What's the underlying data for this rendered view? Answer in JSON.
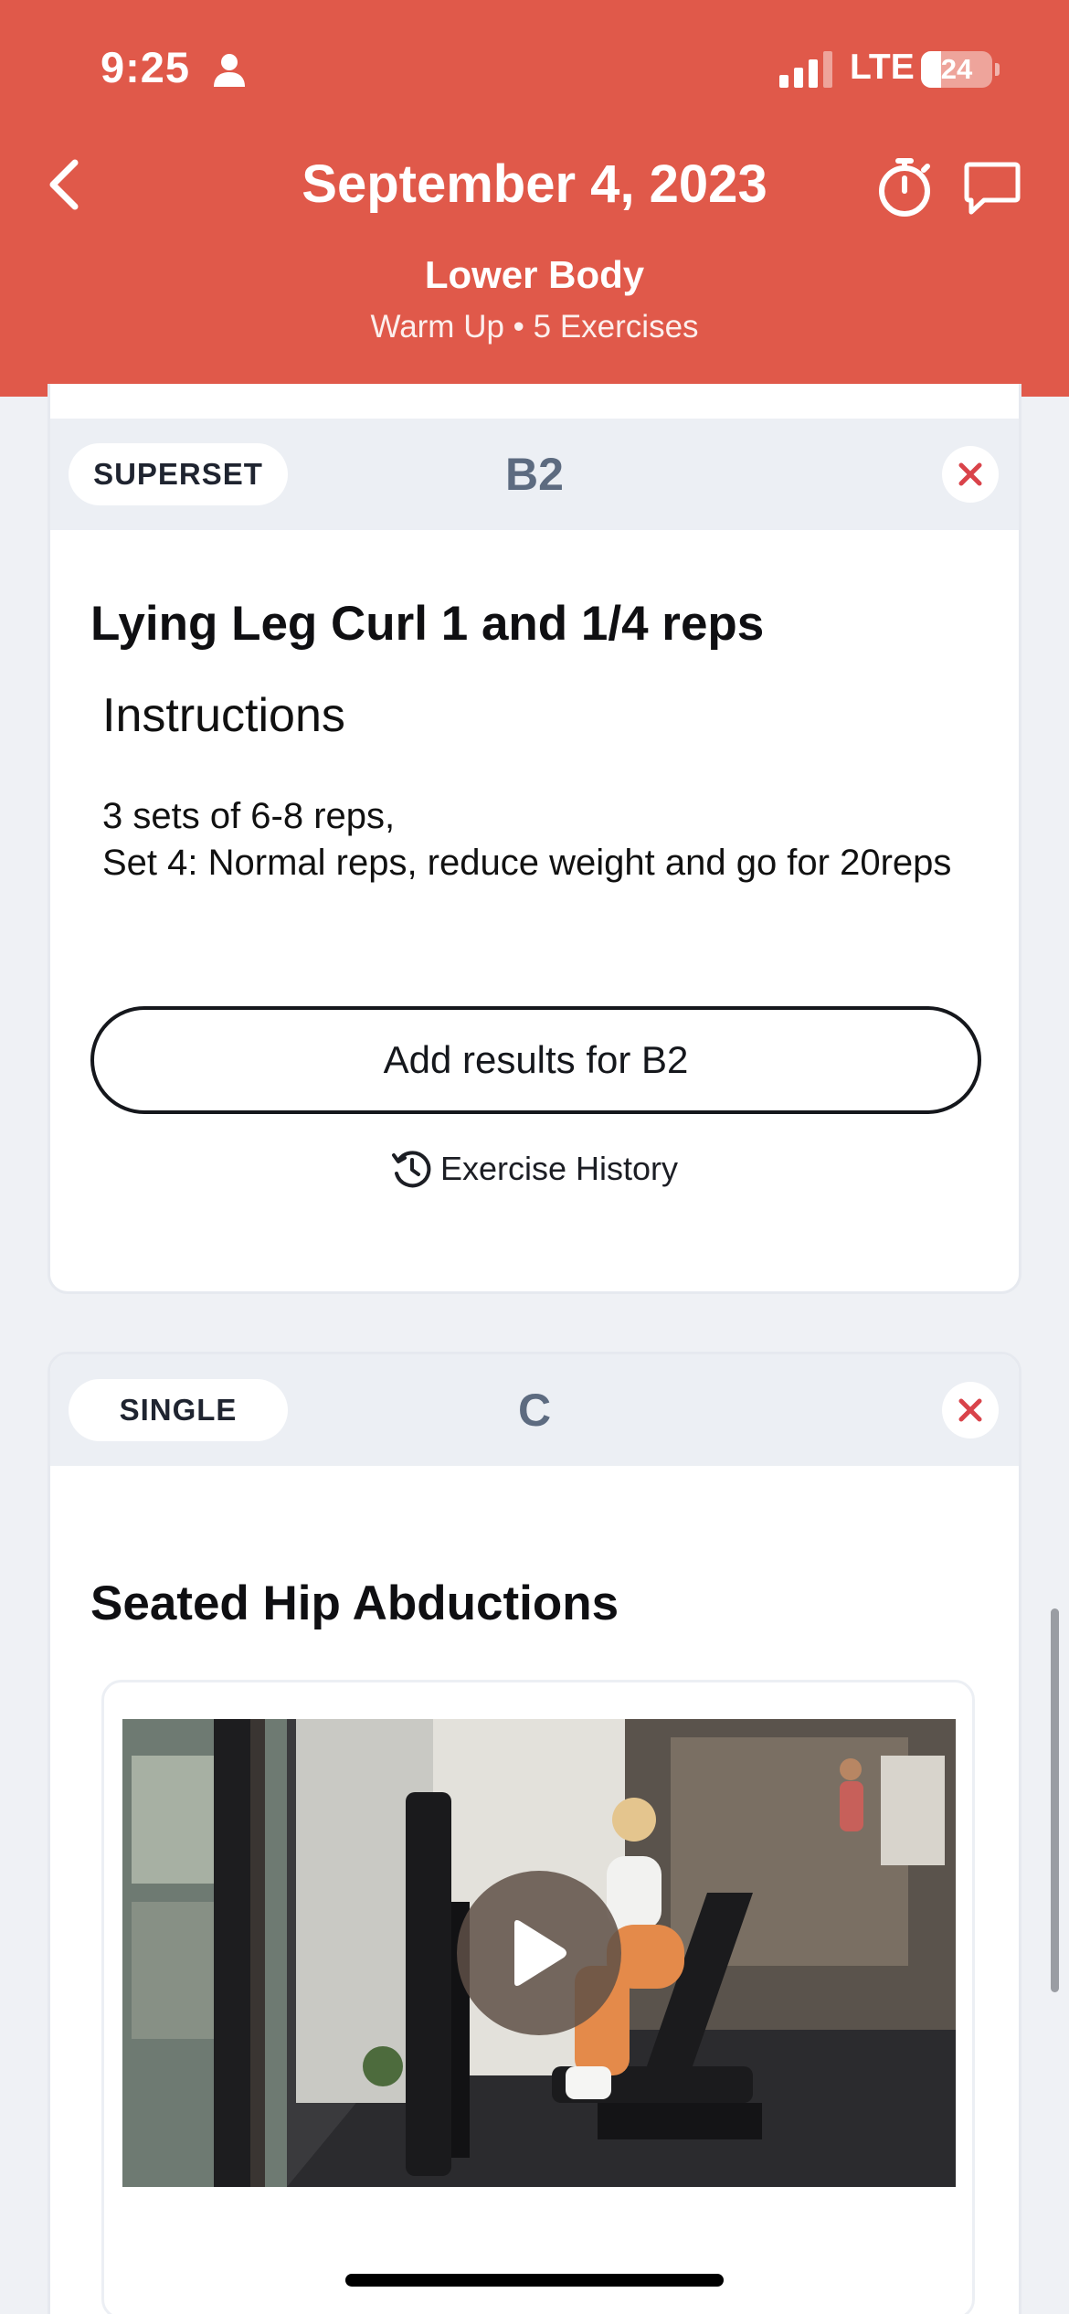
{
  "status_bar": {
    "time": "9:25",
    "network": "LTE",
    "battery": "24",
    "icons": [
      "person-icon",
      "signal-icon",
      "battery-icon"
    ]
  },
  "header": {
    "title": "September 4, 2023",
    "workout_name": "Lower Body",
    "workout_meta": "Warm Up • 5 Exercises",
    "icons": [
      "chevron-left-icon",
      "stopwatch-icon",
      "chat-bubble-icon"
    ],
    "background_color": "#e0594a"
  },
  "cards": [
    {
      "type": "SUPERSET",
      "group": "B2",
      "exercise": "Lying Leg Curl 1 and 1/4 reps",
      "instructions_heading": "Instructions",
      "instructions": [
        "3 sets of 6-8 reps,",
        "Set 4: Normal reps, reduce weight and go for 20reps"
      ],
      "add_results_label": "Add results for B2",
      "history_label": "Exercise History",
      "icons": [
        "close-icon",
        "history-icon"
      ]
    },
    {
      "type": "SINGLE",
      "group": "C",
      "exercise": "Seated Hip Abductions",
      "video": {
        "icon": "play-icon"
      },
      "icons": [
        "close-icon",
        "play-icon"
      ]
    }
  ],
  "colors": {
    "accent": "#e0594a",
    "remove_x": "#d9434a",
    "group_label": "#5d6b80",
    "card_header_bg": "#eceff4"
  }
}
